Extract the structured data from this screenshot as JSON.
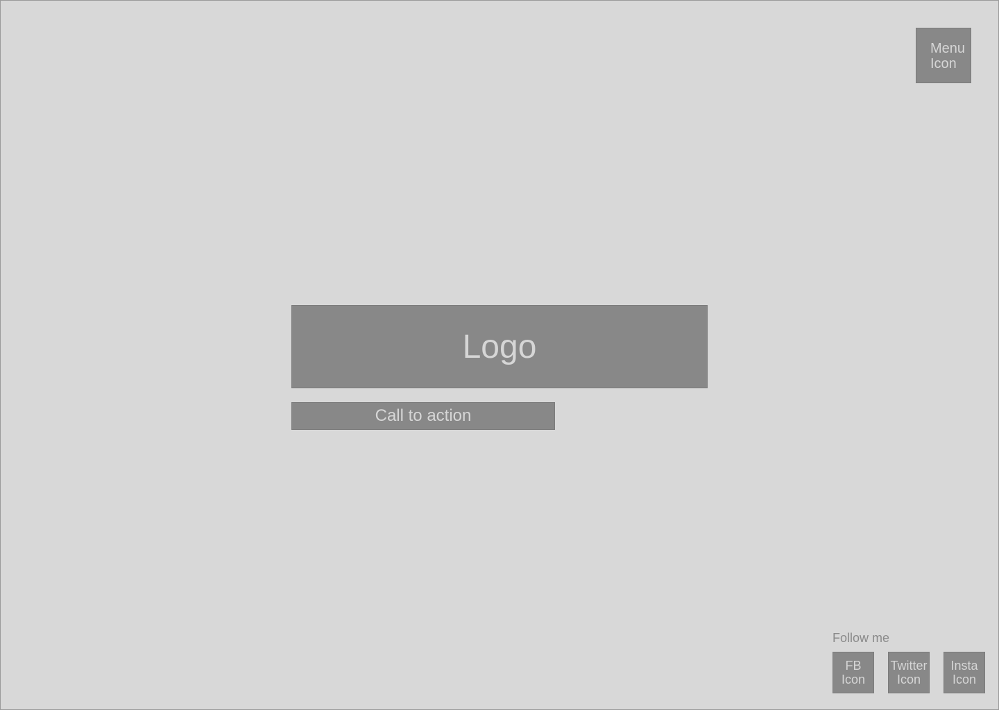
{
  "header": {
    "menu_icon": {
      "line1": "Menu",
      "line2": "Icon",
      "icon": "menu-icon"
    }
  },
  "hero": {
    "logo_text": "Logo",
    "cta_label": "Call to action"
  },
  "footer": {
    "follow_label": "Follow me",
    "social": [
      {
        "line1": "FB",
        "line2": "Icon",
        "icon": "facebook-icon"
      },
      {
        "line1": "Twitter",
        "line2": "Icon",
        "icon": "twitter-icon"
      },
      {
        "line1": "Insta",
        "line2": "Icon",
        "icon": "instagram-icon"
      }
    ]
  },
  "colors": {
    "background": "#d8d8d8",
    "placeholder_fill": "#888888",
    "placeholder_text": "#d6d6d6",
    "muted_text": "#8a8a8a"
  }
}
